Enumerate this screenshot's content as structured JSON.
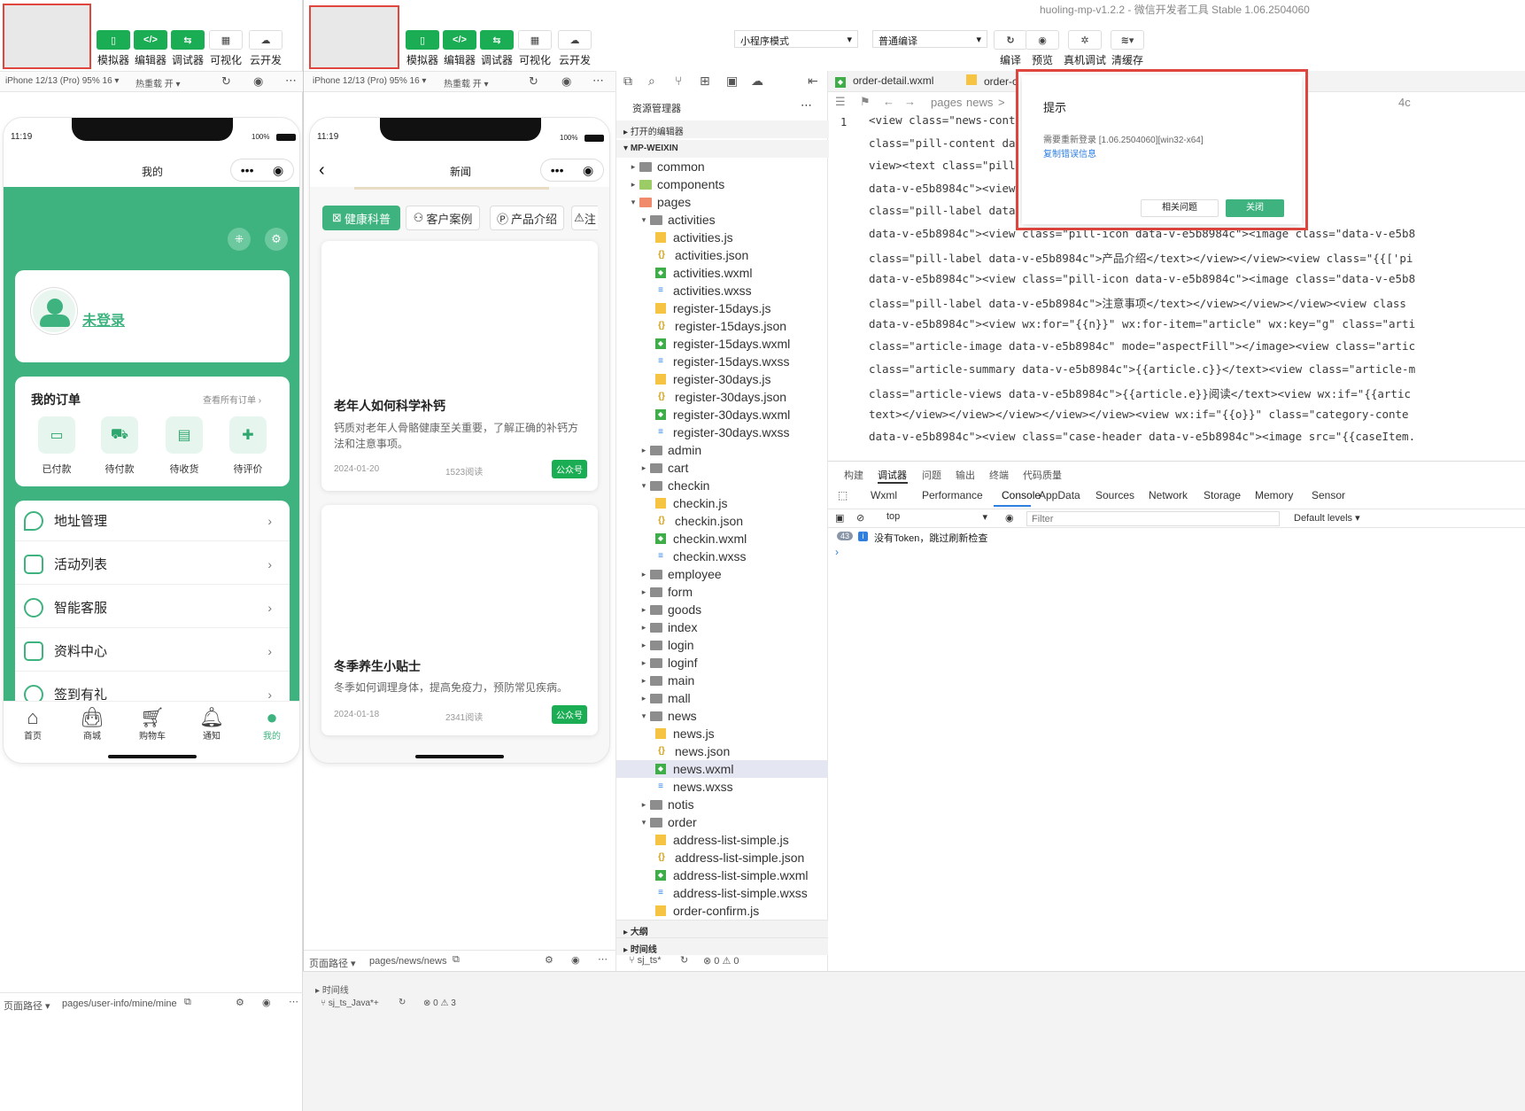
{
  "window_title": "huoling-mp-v1.2.2 - 微信开发者工具 Stable 1.06.2504060",
  "toolbar": {
    "simulator": "模拟器",
    "editor": "编辑器",
    "debugger": "调试器",
    "visual": "可视化",
    "cloud": "云开发",
    "mode_select": "小程序模式",
    "compile_select": "普通编译",
    "compile": "编译",
    "preview": "预览",
    "real_debug": "真机调试",
    "clear_cache": "清缓存"
  },
  "left_sim": {
    "device": "iPhone 12/13 (Pro) 95% 16 ▾",
    "hotreload": "热重载 开 ▾",
    "time": "11:19",
    "battery": "100%",
    "title": "我的",
    "login_text": "未登录",
    "orders_title": "我的订单",
    "orders_all": "查看所有订单",
    "order_items": [
      "已付款",
      "待付款",
      "待收货",
      "待评价"
    ],
    "menu": [
      "地址管理",
      "活动列表",
      "智能客服",
      "资料中心",
      "签到有礼"
    ],
    "tabbar": [
      "首页",
      "商城",
      "购物车",
      "通知",
      "我的"
    ],
    "path_label": "页面路径 ▾",
    "path": "pages/user-info/mine/mine"
  },
  "main_sim": {
    "device": "iPhone 12/13 (Pro) 95% 16 ▾",
    "hotreload": "热重载 开 ▾",
    "time": "11:19",
    "battery": "100%",
    "title": "新闻",
    "pills": [
      "健康科普",
      "客户案例",
      "产品介绍",
      "注"
    ],
    "articles": [
      {
        "title": "老年人如何科学补钙",
        "summary": "钙质对老年人骨骼健康至关重要，了解正确的补钙方法和注意事项。",
        "date": "2024-01-20",
        "views": "1523阅读",
        "badge": "公众号"
      },
      {
        "title": "冬季养生小贴士",
        "summary": "冬季如何调理身体，提高免疫力，预防常见疾病。",
        "date": "2024-01-18",
        "views": "2341阅读",
        "badge": "公众号"
      }
    ],
    "path_label": "页面路径 ▾",
    "path": "pages/news/news"
  },
  "explorer": {
    "title": "资源管理器",
    "open_editors": "打开的编辑器",
    "project": "MP-WEIXIN",
    "tree": [
      {
        "d": 0,
        "t": "folder",
        "open": false,
        "n": "common"
      },
      {
        "d": 0,
        "t": "folder",
        "open": false,
        "n": "components"
      },
      {
        "d": 0,
        "t": "folder",
        "open": true,
        "n": "pages"
      },
      {
        "d": 1,
        "t": "folder",
        "open": true,
        "n": "activities"
      },
      {
        "d": 2,
        "t": "js",
        "n": "activities.js"
      },
      {
        "d": 2,
        "t": "json",
        "n": "activities.json"
      },
      {
        "d": 2,
        "t": "wxml",
        "n": "activities.wxml"
      },
      {
        "d": 2,
        "t": "wxss",
        "n": "activities.wxss"
      },
      {
        "d": 2,
        "t": "js",
        "n": "register-15days.js"
      },
      {
        "d": 2,
        "t": "json",
        "n": "register-15days.json"
      },
      {
        "d": 2,
        "t": "wxml",
        "n": "register-15days.wxml"
      },
      {
        "d": 2,
        "t": "wxss",
        "n": "register-15days.wxss"
      },
      {
        "d": 2,
        "t": "js",
        "n": "register-30days.js"
      },
      {
        "d": 2,
        "t": "json",
        "n": "register-30days.json"
      },
      {
        "d": 2,
        "t": "wxml",
        "n": "register-30days.wxml"
      },
      {
        "d": 2,
        "t": "wxss",
        "n": "register-30days.wxss"
      },
      {
        "d": 1,
        "t": "folder",
        "open": false,
        "n": "admin"
      },
      {
        "d": 1,
        "t": "folder",
        "open": false,
        "n": "cart"
      },
      {
        "d": 1,
        "t": "folder",
        "open": true,
        "n": "checkin"
      },
      {
        "d": 2,
        "t": "js",
        "n": "checkin.js"
      },
      {
        "d": 2,
        "t": "json",
        "n": "checkin.json"
      },
      {
        "d": 2,
        "t": "wxml",
        "n": "checkin.wxml"
      },
      {
        "d": 2,
        "t": "wxss",
        "n": "checkin.wxss"
      },
      {
        "d": 1,
        "t": "folder",
        "open": false,
        "n": "employee"
      },
      {
        "d": 1,
        "t": "folder",
        "open": false,
        "n": "form"
      },
      {
        "d": 1,
        "t": "folder",
        "open": false,
        "n": "goods"
      },
      {
        "d": 1,
        "t": "folder",
        "open": false,
        "n": "index"
      },
      {
        "d": 1,
        "t": "folder",
        "open": false,
        "n": "login"
      },
      {
        "d": 1,
        "t": "folder",
        "open": false,
        "n": "loginf"
      },
      {
        "d": 1,
        "t": "folder",
        "open": false,
        "n": "main"
      },
      {
        "d": 1,
        "t": "folder",
        "open": false,
        "n": "mall"
      },
      {
        "d": 1,
        "t": "folder",
        "open": true,
        "n": "news"
      },
      {
        "d": 2,
        "t": "js",
        "n": "news.js"
      },
      {
        "d": 2,
        "t": "json",
        "n": "news.json"
      },
      {
        "d": 2,
        "t": "wxml",
        "n": "news.wxml",
        "sel": true
      },
      {
        "d": 2,
        "t": "wxss",
        "n": "news.wxss"
      },
      {
        "d": 1,
        "t": "folder",
        "open": false,
        "n": "notis"
      },
      {
        "d": 1,
        "t": "folder",
        "open": true,
        "n": "order"
      },
      {
        "d": 2,
        "t": "js",
        "n": "address-list-simple.js"
      },
      {
        "d": 2,
        "t": "json",
        "n": "address-list-simple.json"
      },
      {
        "d": 2,
        "t": "wxml",
        "n": "address-list-simple.wxml"
      },
      {
        "d": 2,
        "t": "wxss",
        "n": "address-list-simple.wxss"
      },
      {
        "d": 2,
        "t": "js",
        "n": "order-confirm.js"
      }
    ],
    "outline": "大纲",
    "timeline": "时间线",
    "branch": "sj_ts*",
    "status": "⊗ 0 ⚠ 0"
  },
  "bottom_left": {
    "timeline": "时间线",
    "branch": "sj_ts_Java*+",
    "status": "⊗ 0 ⚠ 3"
  },
  "editor": {
    "tabs": [
      "order-detail.wxml",
      "order-c"
    ],
    "breadcrumb": [
      "pages",
      "news",
      ">",
      "4c"
    ],
    "line_no": "1",
    "lines": [
      [
        "<view",
        " class=",
        "\"news-conta",
        "                                          iner data-v-e"
      ],
      [
        "",
        "class=",
        "\"pill-content dat",
        "                                         b8984c\"><imag"
      ],
      [
        "view><text",
        " class=",
        "\"pill-",
        "                                         /view><view c"
      ],
      [
        "",
        "data-v-e5b8984c\"><view",
        "",
        "                                         =\"data-v-e5b8"
      ],
      [
        "",
        "class=",
        "\"pill-label data-",
        "                                         class=\"{{['pi"
      ],
      [
        "",
        "data-v-e5b8984c\"><view class=\"pill-icon data-v-e5b8984c\"><image class=\"data-v-e5b8",
        "",
        ""
      ],
      [
        "",
        "class=\"pill-label data-v-e5b8984c\">产品介绍</text></view></view><view class=\"{{['pi",
        "",
        ""
      ],
      [
        "",
        "data-v-e5b8984c\"><view class=\"pill-icon data-v-e5b8984c\"><image class=\"data-v-e5b8",
        "",
        ""
      ],
      [
        "",
        "class=\"pill-label data-v-e5b8984c\">注意事项</text></view></view></view><view class",
        "",
        ""
      ],
      [
        "",
        "data-v-e5b8984c\"><view wx:for=\"{{n}}\" wx:for-item=\"article\" wx:key=\"g\" class=\"arti",
        "",
        ""
      ],
      [
        "",
        "class=\"article-image data-v-e5b8984c\" mode=\"aspectFill\"></image><view class=\"artic",
        "",
        ""
      ],
      [
        "",
        "class=\"article-summary data-v-e5b8984c\">{{article.c}}</text><view class=\"article-m",
        "",
        ""
      ],
      [
        "",
        "class=\"article-views data-v-e5b8984c\">{{article.e}}阅读</text><view wx:if=\"{{artic",
        "",
        ""
      ],
      [
        "",
        "text></view></view></view></view></view><view wx:if=\"{{o}}\" class=\"category-conte",
        "",
        ""
      ],
      [
        "",
        "data-v-e5b8984c\"><view class=\"case-header data-v-e5b8984c\"><image src=\"{{caseItem.",
        "",
        ""
      ]
    ]
  },
  "debug": {
    "top_tabs": [
      "构建",
      "调试器",
      "问题",
      "输出",
      "终端",
      "代码质量"
    ],
    "tabs": [
      "Wxml",
      "Performance",
      "Console",
      "AppData",
      "Sources",
      "Network",
      "Storage",
      "Memory",
      "Sensor"
    ],
    "context": "top",
    "filter_placeholder": "Filter",
    "levels": "Default levels ▾",
    "log_count": "43",
    "log_text": "没有Token，跳过刷新检查"
  },
  "dialog": {
    "title": "提示",
    "message": "需要重新登录 [1.06.2504060][win32-x64]",
    "link": "复制错误信息",
    "btn_related": "相关问题",
    "btn_close": "关闭"
  },
  "colors": {
    "brand_green": "#1aad53",
    "page_green": "#3fb37f",
    "alert_red": "#e0463e",
    "link_blue": "#2f7fe0"
  }
}
